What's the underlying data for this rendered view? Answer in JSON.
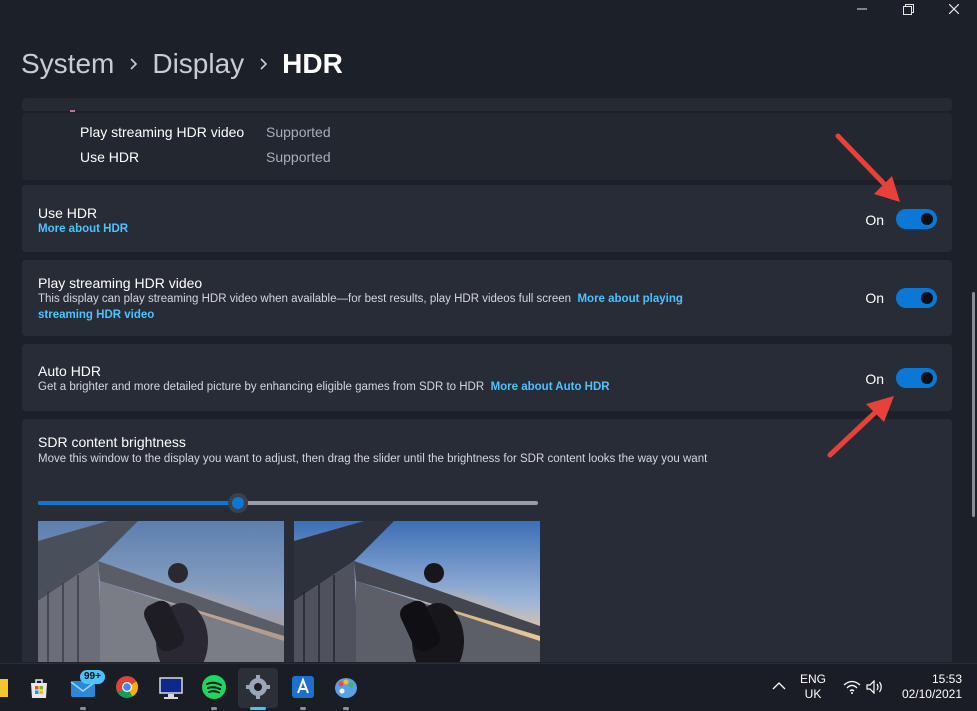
{
  "window": {
    "controls": [
      "minimize",
      "restore",
      "close"
    ]
  },
  "breadcrumb": {
    "items": [
      "System",
      "Display",
      "HDR"
    ]
  },
  "capabilities": [
    {
      "label": "Play streaming HDR video",
      "value": "Supported"
    },
    {
      "label": "Use HDR",
      "value": "Supported"
    }
  ],
  "settings": {
    "use_hdr": {
      "title": "Use HDR",
      "link": "More about HDR",
      "state": "On"
    },
    "streaming": {
      "title": "Play streaming HDR video",
      "desc": "This display can play streaming HDR video when available—for best results, play HDR videos full screen",
      "link_line1": "More about playing",
      "link_line2": "streaming HDR video",
      "state": "On"
    },
    "auto_hdr": {
      "title": "Auto HDR",
      "desc": "Get a brighter and more detailed picture by enhancing eligible games from SDR to HDR",
      "link": "More about Auto HDR",
      "state": "On"
    },
    "sdr": {
      "title": "SDR content brightness",
      "desc": "Move this window to the display you want to adjust, then drag the slider until the brightness for SDR content looks the way you want",
      "slider_value_fraction": 0.4
    }
  },
  "taskbar": {
    "mail_badge": "99+",
    "apps": [
      "explorer-icon",
      "store-icon",
      "mail-icon",
      "chrome-icon",
      "monitor-app-icon",
      "spotify-icon",
      "settings-icon",
      "app-icon",
      "paint-icon"
    ]
  },
  "tray": {
    "lang_line1": "ENG",
    "lang_line2": "UK",
    "time": "15:53",
    "date": "02/10/2021"
  },
  "colors": {
    "accent": "#0a78d4",
    "link": "#4cc2ff",
    "arrow": "#e8403a"
  }
}
